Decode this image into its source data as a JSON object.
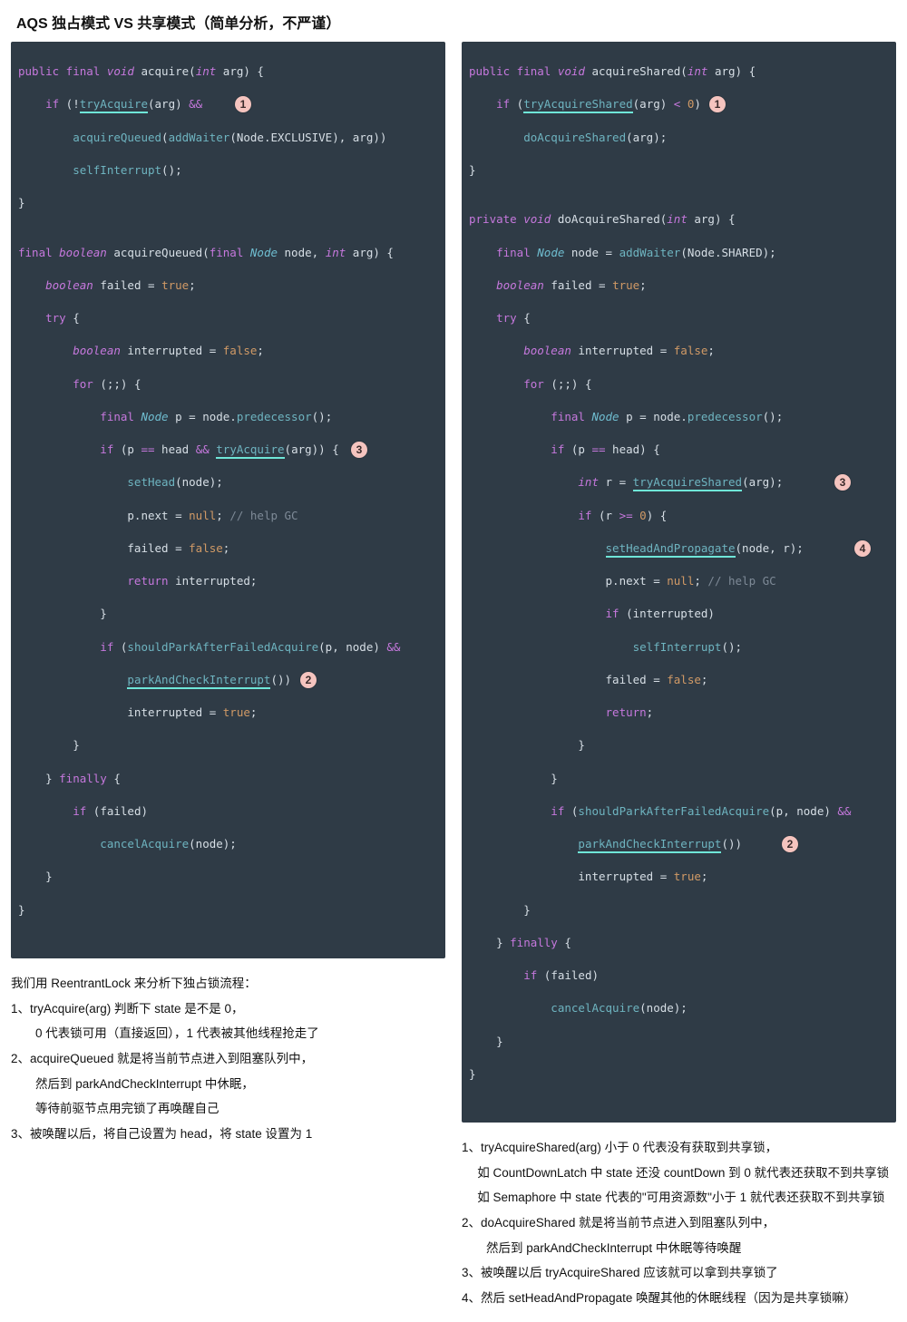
{
  "title": "AQS 独占模式 VS 共享模式（简单分析，不严谨）",
  "badge1": "1",
  "badge2": "2",
  "badge3": "3",
  "badge4": "4",
  "left_notes": [
    "我们用 ReentrantLock  来分析下独占锁流程：",
    "1、tryAcquire(arg) 判断下 state 是不是 0，",
    "　　0 代表锁可用（直接返回），1 代表被其他线程抢走了",
    "2、acquireQueued 就是将当前节点进入到阻塞队列中，",
    "　　然后到 parkAndCheckInterrupt 中休眠，",
    "　　等待前驱节点用完锁了再唤醒自己",
    "3、被唤醒以后，将自己设置为 head，将 state 设置为 1"
  ],
  "right_notes": [
    "1、tryAcquireShared(arg) 小于 0 代表没有获取到共享锁，",
    "　 如 CountDownLatch 中 state 还没 countDown 到 0 就代表还获取不到共享锁",
    "　 如 Semaphore 中 state 代表的\"可用资源数\"小于 1 就代表还获取不到共享锁",
    "2、doAcquireShared 就是将当前节点进入到阻塞队列中，",
    "　　然后到 parkAndCheckInterrupt 中休眠等待唤醒",
    "3、被唤醒以后 tryAcquireShared 应该就可以拿到共享锁了",
    "4、然后 setHeadAndPropagate 唤醒其他的休眠线程（因为是共享锁嘛）"
  ],
  "left_code": {
    "l1": {
      "a": "public final ",
      "b": "void",
      "c": " acquire(",
      "d": "int",
      "e": " arg) {"
    },
    "l2": {
      "a": "    if",
      "b": " (!",
      "c": "tryAcquire",
      "d": "(arg) ",
      "e": "&&"
    },
    "l3": {
      "a": "        acquireQueued",
      "b": "(",
      "c": "addWaiter",
      "d": "(Node.EXCLUSIVE), arg))"
    },
    "l4": {
      "a": "        selfInterrupt",
      "b": "();"
    },
    "l5": "}",
    "l6": "",
    "l7": {
      "a": "final ",
      "b": "boolean",
      "c": " acquireQueued(",
      "d": "final ",
      "e": "Node",
      "f": " node, ",
      "g": "int",
      "h": " arg) {"
    },
    "l8": {
      "a": "    boolean",
      "b": " failed = ",
      "c": "true",
      ";": ";"
    },
    "l9": {
      "a": "    try",
      "b": " {"
    },
    "l10": {
      "a": "        boolean",
      "b": " interrupted = ",
      "c": "false",
      ";": ";"
    },
    "l11": {
      "a": "        for",
      "b": " (;;) {"
    },
    "l12": {
      "a": "            final ",
      "b": "Node",
      "c": " p = node.",
      "d": "predecessor",
      "e": "();"
    },
    "l13": {
      "a": "            if",
      "b": " (p ",
      "c": "==",
      "d": " head ",
      "e": "&&",
      "f": " ",
      "g": "tryAcquire",
      "h": "(arg)) {"
    },
    "l14": {
      "a": "                setHead",
      "b": "(node);"
    },
    "l15": {
      "a": "                p.next = ",
      "b": "null",
      "c": "; ",
      "d": "// help GC"
    },
    "l16": {
      "a": "                failed = ",
      "b": "false",
      ";": ";"
    },
    "l17": {
      "a": "                return",
      "b": " interrupted;"
    },
    "l18": "            }",
    "l19": {
      "a": "            if",
      "b": " (",
      "c": "shouldParkAfterFailedAcquire",
      "d": "(p, node) ",
      "e": "&&"
    },
    "l20": {
      "a": "                ",
      "b": "parkAndCheckInterrupt",
      "c": "())"
    },
    "l21": {
      "a": "                interrupted = ",
      "b": "true",
      ";": ";"
    },
    "l22": "        }",
    "l23": {
      "a": "    } ",
      "b": "finally",
      "c": " {"
    },
    "l24": {
      "a": "        if",
      "b": " (failed)"
    },
    "l25": {
      "a": "            cancelAcquire",
      "b": "(node);"
    },
    "l26": "    }",
    "l27": "}"
  },
  "right_code": {
    "l1": {
      "a": "public final ",
      "b": "void",
      "c": " acquireShared(",
      "d": "int",
      "e": " arg) {"
    },
    "l2": {
      "a": "    if",
      "b": " (",
      "c": "tryAcquireShared",
      "d": "(arg) ",
      "e": "<",
      "f": " ",
      "g": "0",
      "h": ")"
    },
    "l3": {
      "a": "        doAcquireShared",
      "b": "(arg);"
    },
    "l4": "}",
    "l5": "",
    "l6": {
      "a": "private ",
      "b": "void",
      "c": " doAcquireShared(",
      "d": "int",
      "e": " arg) {"
    },
    "l7": {
      "a": "    final ",
      "b": "Node",
      "c": " node = ",
      "d": "addWaiter",
      "e": "(Node.SHARED);"
    },
    "l8": {
      "a": "    boolean",
      "b": " failed = ",
      "c": "true",
      ";": ";"
    },
    "l9": {
      "a": "    try",
      "b": " {"
    },
    "l10": {
      "a": "        boolean",
      "b": " interrupted = ",
      "c": "false",
      ";": ";"
    },
    "l11": {
      "a": "        for",
      "b": " (;;) {"
    },
    "l12": {
      "a": "            final ",
      "b": "Node",
      "c": " p = node.",
      "d": "predecessor",
      "e": "();"
    },
    "l13": {
      "a": "            if",
      "b": " (p ",
      "c": "==",
      "d": " head) {"
    },
    "l14": {
      "a": "                int",
      "b": " r = ",
      "c": "tryAcquireShared",
      "d": "(arg);"
    },
    "l15": {
      "a": "                if",
      "b": " (r ",
      "c": ">=",
      "d": " ",
      "e": "0",
      "f": ") {"
    },
    "l16": {
      "a": "                    ",
      "b": "setHeadAndPropagate",
      "c": "(node, r);"
    },
    "l17": {
      "a": "                    p.next = ",
      "b": "null",
      "c": "; ",
      "d": "// help GC"
    },
    "l18": {
      "a": "                    if",
      "b": " (interrupted)"
    },
    "l19": {
      "a": "                        selfInterrupt",
      "b": "();"
    },
    "l20": {
      "a": "                    failed = ",
      "b": "false",
      ";": ";"
    },
    "l21": {
      "a": "                    return",
      ";": ";"
    },
    "l22": "                }",
    "l23": "            }",
    "l24": {
      "a": "            if",
      "b": " (",
      "c": "shouldParkAfterFailedAcquire",
      "d": "(p, node) ",
      "e": "&&"
    },
    "l25": {
      "a": "                ",
      "b": "parkAndCheckInterrupt",
      "c": "())"
    },
    "l26": {
      "a": "                interrupted = ",
      "b": "true",
      ";": ";"
    },
    "l27": "        }",
    "l28": {
      "a": "    } ",
      "b": "finally",
      "c": " {"
    },
    "l29": {
      "a": "        if",
      "b": " (failed)"
    },
    "l30": {
      "a": "            cancelAcquire",
      "b": "(node);"
    },
    "l31": "    }",
    "l32": "}"
  }
}
